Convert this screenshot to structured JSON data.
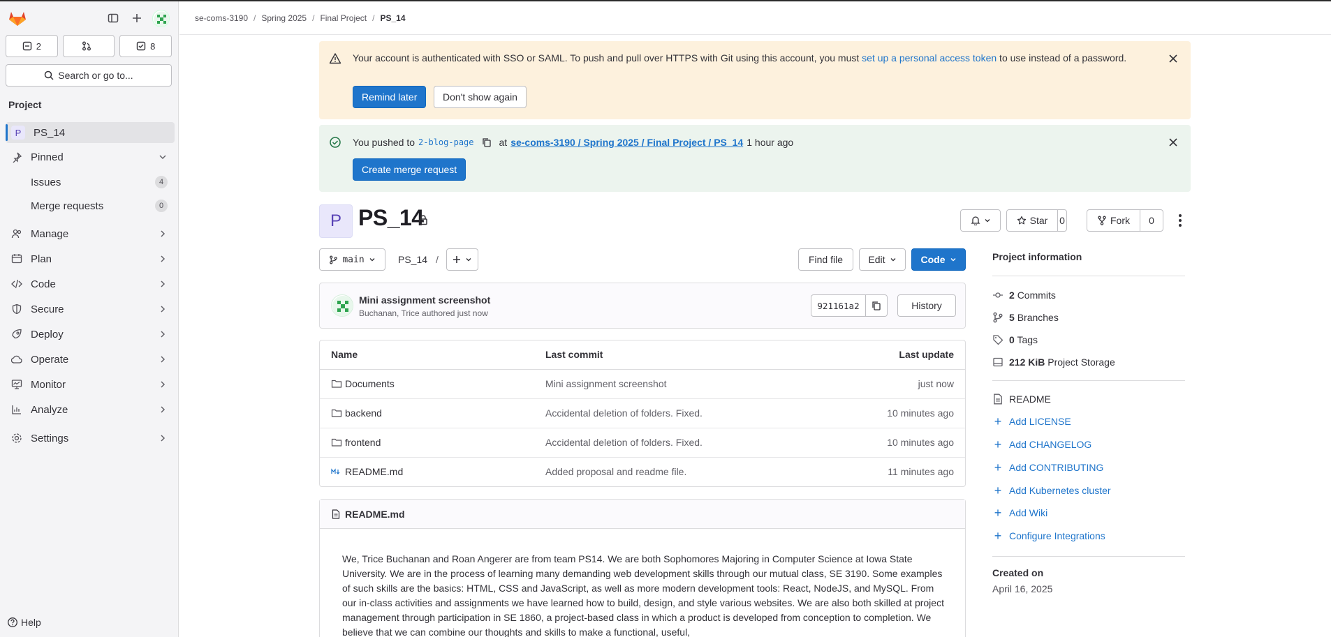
{
  "sidebar": {
    "counts": {
      "issues": "2",
      "merge_requests": "",
      "todos": "8"
    },
    "search_label": "Search or go to...",
    "section_label": "Project",
    "project": {
      "badge": "P",
      "name": "PS_14"
    },
    "pinned_label": "Pinned",
    "pinned_items": [
      {
        "label": "Issues",
        "count": "4"
      },
      {
        "label": "Merge requests",
        "count": "0"
      }
    ],
    "nav": [
      {
        "label": "Manage",
        "icon": "users-icon"
      },
      {
        "label": "Plan",
        "icon": "calendar-icon"
      },
      {
        "label": "Code",
        "icon": "code-icon"
      },
      {
        "label": "Secure",
        "icon": "shield-icon"
      },
      {
        "label": "Deploy",
        "icon": "rocket-icon"
      },
      {
        "label": "Operate",
        "icon": "cloud-icon"
      },
      {
        "label": "Monitor",
        "icon": "monitor-icon"
      },
      {
        "label": "Analyze",
        "icon": "chart-icon"
      },
      {
        "label": "Settings",
        "icon": "gear-icon"
      }
    ],
    "help_label": "Help"
  },
  "breadcrumb": [
    "se-coms-3190",
    "Spring 2025",
    "Final Project",
    "PS_14"
  ],
  "alerts": {
    "sso": {
      "text_before": "Your account is authenticated with SSO or SAML. To push and pull over HTTPS with Git using this account, you must ",
      "link": "set up a personal access token",
      "text_after": " to use instead of a password.",
      "remind_label": "Remind later",
      "dismiss_label": "Don't show again"
    },
    "push": {
      "prefix": "You pushed to",
      "branch": "2-blog-page",
      "at": "at",
      "project_link": "se-coms-3190 / Spring 2025 / Final Project / PS_14",
      "time": "1 hour ago",
      "button": "Create merge request"
    }
  },
  "project": {
    "badge": "P",
    "title": "PS_14",
    "star_label": "Star",
    "star_count": "0",
    "fork_label": "Fork",
    "fork_count": "0"
  },
  "toolbar": {
    "branch": "main",
    "path": "PS_14",
    "path_sep": "/",
    "find_file": "Find file",
    "edit": "Edit",
    "code": "Code"
  },
  "last_commit": {
    "title": "Mini assignment screenshot",
    "author": "Buchanan, Trice",
    "meta_suffix": " authored just now",
    "sha": "921161a2",
    "history": "History"
  },
  "files": {
    "headers": {
      "name": "Name",
      "last_commit": "Last commit",
      "last_update": "Last update"
    },
    "rows": [
      {
        "name": "Documents",
        "type": "folder",
        "commit": "Mini assignment screenshot",
        "updated": "just now"
      },
      {
        "name": "backend",
        "type": "folder",
        "commit": "Accidental deletion of folders. Fixed.",
        "updated": "10 minutes ago"
      },
      {
        "name": "frontend",
        "type": "folder",
        "commit": "Accidental deletion of folders. Fixed.",
        "updated": "10 minutes ago"
      },
      {
        "name": "README.md",
        "type": "markdown",
        "commit": "Added proposal and readme file.",
        "updated": "11 minutes ago"
      }
    ]
  },
  "readme": {
    "filename": "README.md",
    "body": "We, Trice Buchanan and Roan Angerer are from team PS14. We are both Sophomores Majoring in Computer Science at Iowa State University. We are in the process of learning many demanding web development skills through our mutual class, SE 3190. Some examples of such skills are the basics: HTML, CSS and JavaScript, as well as more modern development tools: React, NodeJS, and MySQL. From our in-class activities and assignments we have learned how to build, design, and style various websites. We are also both skilled at project management through participation in SE 1860, a project-based class in which a product is developed from conception to completion. We believe that we can combine our thoughts and skills to make a functional, useful,"
  },
  "info": {
    "title": "Project information",
    "stats": [
      {
        "icon": "commit-icon",
        "value": "2",
        "label": "Commits"
      },
      {
        "icon": "branch-icon",
        "value": "5",
        "label": "Branches"
      },
      {
        "icon": "tag-icon",
        "value": "0",
        "label": "Tags"
      },
      {
        "icon": "storage-icon",
        "value": "212 KiB",
        "label": "Project Storage"
      }
    ],
    "readme": "README",
    "links": [
      "Add LICENSE",
      "Add CHANGELOG",
      "Add CONTRIBUTING",
      "Add Kubernetes cluster",
      "Add Wiki",
      "Configure Integrations"
    ],
    "created_label": "Created on",
    "created_date": "April 16, 2025"
  },
  "colors": {
    "primary": "#1f75cb",
    "warning_bg": "#fdf1dd",
    "success_bg": "#ecf4ee",
    "project_badge_bg": "#e9e7fb"
  }
}
